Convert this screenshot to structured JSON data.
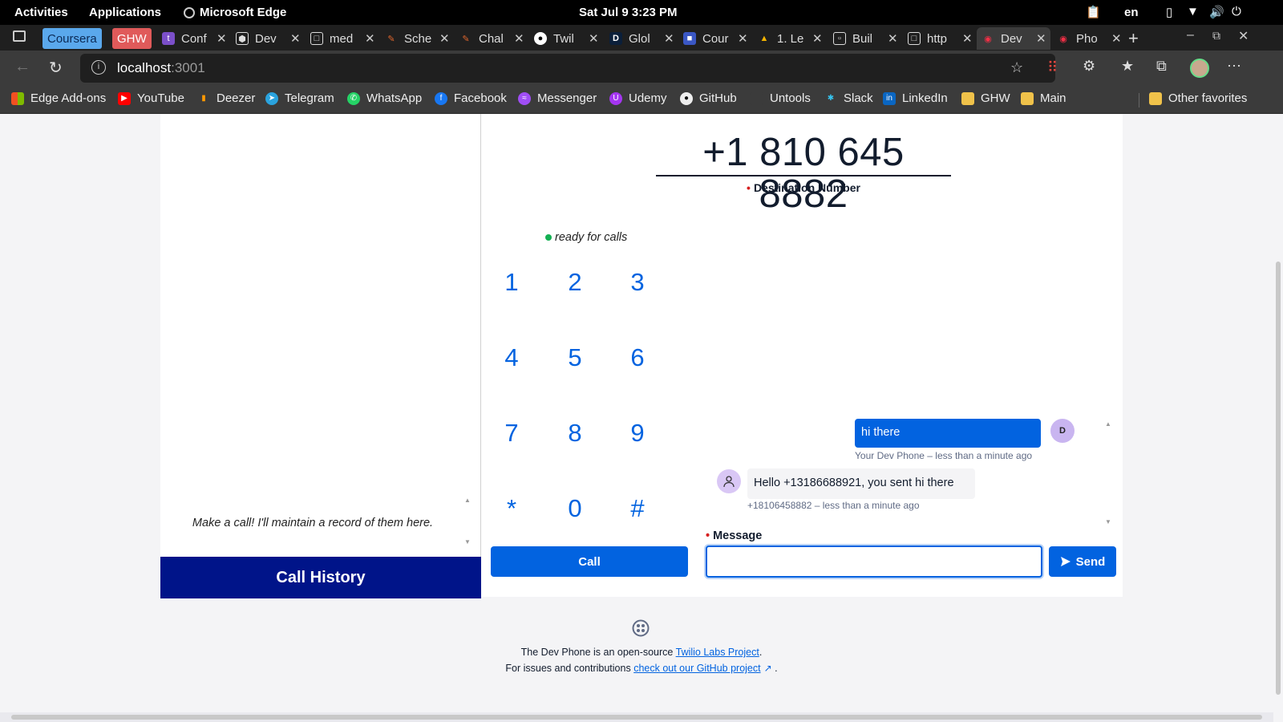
{
  "topbar": {
    "activities": "Activities",
    "applications": "Applications",
    "app_name": "Microsoft Edge",
    "datetime": "Sat Jul 9   3:23 PM",
    "lang": "en"
  },
  "tabs": [
    {
      "label": "Coursera"
    },
    {
      "label": "GHW"
    },
    {
      "label": "Conf"
    },
    {
      "label": "Dev"
    },
    {
      "label": "med"
    },
    {
      "label": "Sche"
    },
    {
      "label": "Chal"
    },
    {
      "label": "Twil"
    },
    {
      "label": "Glol"
    },
    {
      "label": "Cour"
    },
    {
      "label": "1. Le"
    },
    {
      "label": "Buil"
    },
    {
      "label": "http"
    },
    {
      "label": "Dev"
    },
    {
      "label": "Pho"
    }
  ],
  "address": {
    "url_host": "localhost",
    "url_port": ":3001"
  },
  "favorites": [
    {
      "label": "Edge Add-ons"
    },
    {
      "label": "YouTube"
    },
    {
      "label": "Deezer"
    },
    {
      "label": "Telegram"
    },
    {
      "label": "WhatsApp"
    },
    {
      "label": "Facebook"
    },
    {
      "label": "Messenger"
    },
    {
      "label": "Udemy"
    },
    {
      "label": "GitHub"
    },
    {
      "label": "Untools"
    },
    {
      "label": "Slack"
    },
    {
      "label": "LinkedIn"
    },
    {
      "label": "GHW"
    },
    {
      "label": "Main"
    },
    {
      "label": "Other favorites"
    }
  ],
  "history": {
    "empty_text": "Make a call! I'll maintain a record of them here.",
    "title": "Call History"
  },
  "dialer": {
    "phone_number": "+1 810 645 8882",
    "destination_label": "Destination Number",
    "status": "ready for calls",
    "keys": [
      "1",
      "2",
      "3",
      "4",
      "5",
      "6",
      "7",
      "8",
      "9",
      "*",
      "0",
      "#"
    ],
    "call_label": "Call"
  },
  "messages": {
    "outgoing": {
      "text": "hi there",
      "meta": "Your Dev Phone – less than a minute ago",
      "avatar": "D"
    },
    "incoming": {
      "text": "Hello +13186688921, you sent hi there",
      "meta": "+18106458882 – less than a minute ago"
    },
    "label": "Message",
    "input_value": "",
    "send_label": "Send"
  },
  "footer": {
    "line1_prefix": "The Dev Phone is an open-source ",
    "line1_link": "Twilio Labs Project",
    "line1_suffix": ".",
    "line2_prefix": "For issues and contributions ",
    "line2_link": "check out our GitHub project",
    "line2_suffix": " ."
  },
  "colors": {
    "accent": "#0263e0",
    "history_bar": "#001489",
    "status_ok": "#14b053"
  }
}
